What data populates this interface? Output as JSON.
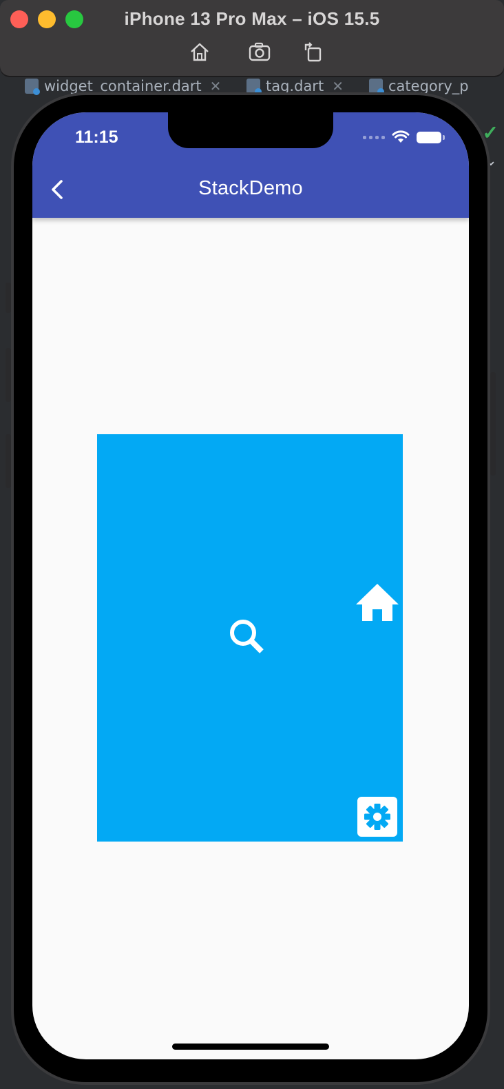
{
  "window": {
    "title": "iPhone 13 Pro Max – iOS 15.5",
    "toolbar": [
      "home-icon",
      "screenshot-icon",
      "rotate-icon"
    ]
  },
  "ide": {
    "tabs": [
      {
        "label": "widget_container.dart"
      },
      {
        "label": "tag.dart"
      },
      {
        "label": "category_p"
      }
    ]
  },
  "status_bar": {
    "time": "11:15"
  },
  "app_bar": {
    "title": "StackDemo",
    "color": "#3f51b5"
  },
  "stack": {
    "color": "#03a9f4",
    "icons": [
      "search-icon",
      "home-icon",
      "settings-icon"
    ]
  },
  "colors": {
    "background": "#fafafa",
    "icon": "#ffffff"
  }
}
